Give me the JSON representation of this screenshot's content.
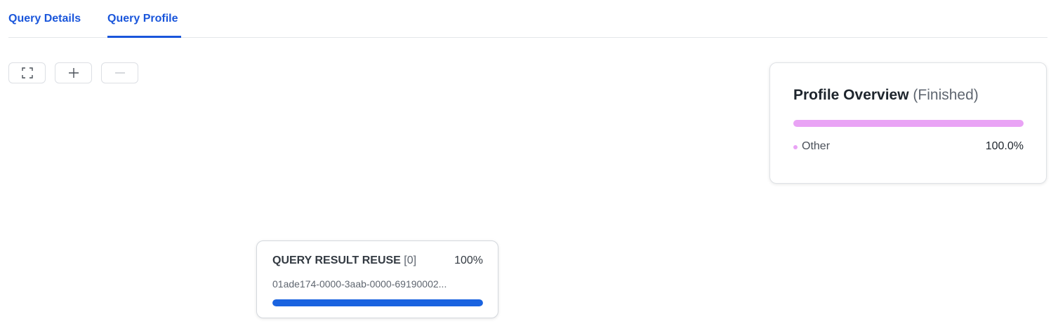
{
  "tabs": [
    {
      "label": "Query Details",
      "active": false
    },
    {
      "label": "Query Profile",
      "active": true
    }
  ],
  "toolbar": {
    "buttons": [
      {
        "icon": "fullscreen-icon"
      },
      {
        "icon": "zoom-in-icon"
      },
      {
        "icon": "zoom-out-icon",
        "disabled": true
      }
    ]
  },
  "overview": {
    "title": "Profile Overview",
    "status": "(Finished)",
    "bar_color": "#e9a3f5",
    "legend": [
      {
        "label": "Other",
        "value": "100.0%",
        "fraction": 1.0,
        "color": "#e9a3f5"
      }
    ]
  },
  "node": {
    "name": "QUERY RESULT REUSE",
    "index": "[0]",
    "percent_label": "100%",
    "progress": 1.0,
    "query_id": "01ade174-0000-3aab-0000-69190002...",
    "bar_color": "#1a63e0"
  },
  "colors": {
    "accent": "#1a56db"
  }
}
